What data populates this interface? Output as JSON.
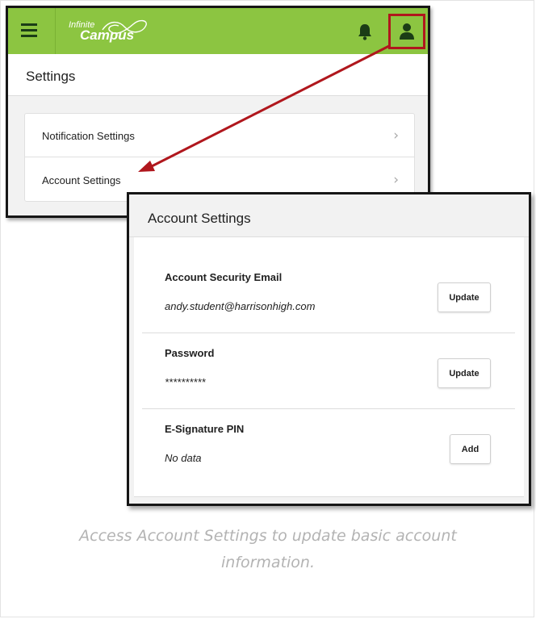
{
  "app": {
    "logo_top": "Infinite",
    "logo_bottom": "Campus",
    "brand_color": "#8cc541"
  },
  "settings": {
    "title": "Settings",
    "items": [
      {
        "label": "Notification Settings",
        "icon": "chevron-right-icon"
      },
      {
        "label": "Account Settings",
        "icon": "chevron-right-icon"
      }
    ]
  },
  "account_settings": {
    "title": "Account Settings",
    "rows": [
      {
        "label": "Account Security Email",
        "value": "andy.student@harrisonhigh.com",
        "button": "Update"
      },
      {
        "label": "Password",
        "value": "**********",
        "button": "Update"
      },
      {
        "label": "E-Signature PIN",
        "value": "No data",
        "button": "Add"
      }
    ]
  },
  "annotation": {
    "highlight_color": "#b0171d"
  },
  "caption": {
    "line1": "Access Account Settings to update basic account",
    "line2": "information."
  }
}
